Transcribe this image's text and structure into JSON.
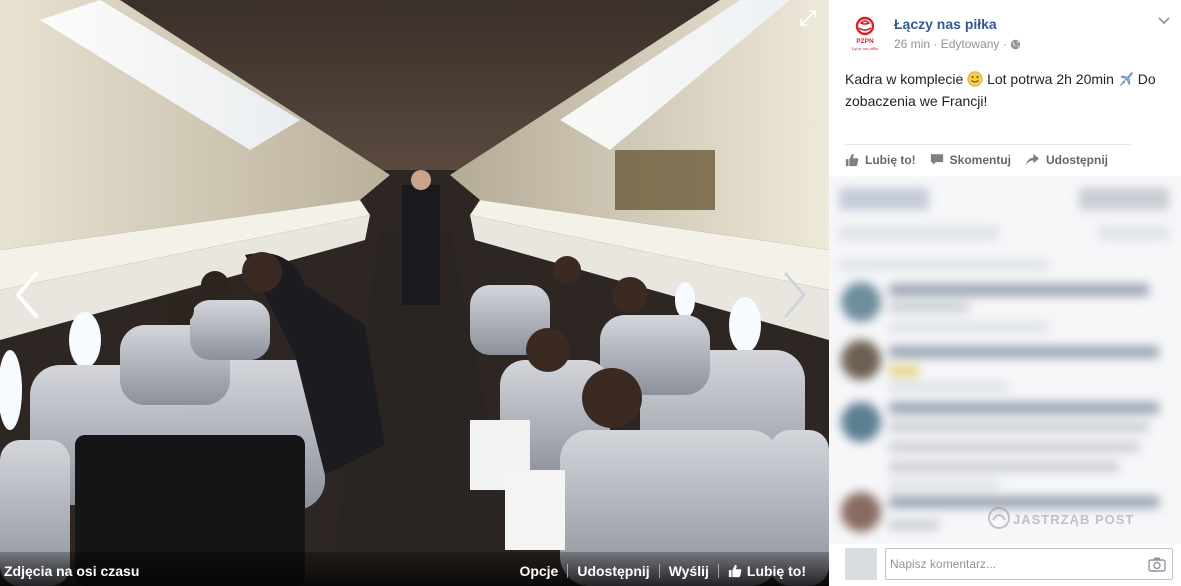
{
  "photo_bar": {
    "album_label": "Zdjęcia na osi czasu",
    "options_label": "Opcje",
    "share_label": "Udostępnij",
    "send_label": "Wyślij",
    "like_label": "Lubię to!"
  },
  "post": {
    "page_name": "Łączy nas piłka",
    "time": "26 min",
    "edited": "Edytowany",
    "separator": "·",
    "text_part1": "Kadra w komplecie",
    "text_part2": "Lot potrwa 2h 20min",
    "text_part3": "Do zobaczenia we Francji!",
    "logo_text": "PZPN",
    "logo_tagline": "Łączy nas piłka"
  },
  "actions": {
    "like": "Lubię to!",
    "comment": "Skomentuj",
    "share": "Udostępnij"
  },
  "comment_box": {
    "placeholder": "Napisz komentarz..."
  },
  "watermark": "JASTRZĄB POST",
  "colors": {
    "link": "#365899",
    "text": "#1d2129",
    "muted": "#90949c",
    "logo_red": "#d8232a"
  },
  "icons": [
    "nav-left-icon",
    "nav-right-icon",
    "expand-icon",
    "globe-icon",
    "chevron-down-icon",
    "thumbs-up-icon",
    "comment-icon",
    "share-icon",
    "camera-icon",
    "smile-emoji-icon",
    "airplane-emoji-icon"
  ]
}
